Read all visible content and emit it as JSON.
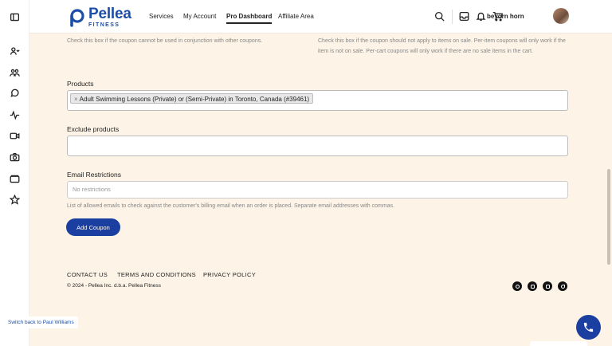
{
  "header": {
    "logo_name": "Pellea",
    "logo_sub": "FITNESS",
    "nav": [
      "Services",
      "My Account",
      "Pro Dashboard",
      "Affiliate Area"
    ],
    "active_nav": "Pro Dashboard",
    "username": "beyorn horn"
  },
  "form": {
    "individual_use_help": "Check this box if the coupon cannot be used in conjunction with other coupons.",
    "exclude_sale_help": "Check this box if the coupon should not apply to items on sale. Per-item coupons will only work if the item is not on sale. Per-cart coupons will only work if there are no sale items in the cart.",
    "products_label": "Products",
    "products_selected": "Adult Swimming Lessons (Private) or (Semi-Private) in Toronto, Canada (#39461)",
    "chip_remove": "×",
    "exclude_products_label": "Exclude products",
    "email_restrictions_label": "Email Restrictions",
    "email_restrictions_placeholder": "No restrictions",
    "email_restrictions_help": "List of allowed emails to check against the customer's billing email when an order is placed. Separate email addresses with commas.",
    "submit_label": "Add Coupon"
  },
  "footer": {
    "links": [
      "CONTACT US",
      "TERMS AND CONDITIONS",
      "PRIVACY POLICY"
    ],
    "copyright": "© 2024 - Pellea Inc. d.b.a. Pellea Fitness",
    "social": [
      "facebook-icon",
      "instagram-icon",
      "linkedin-icon",
      "twitter-icon"
    ]
  },
  "switch_back": "Switch back to Paul Williams",
  "colors": {
    "brand": "#1e4fa8",
    "button": "#1b3fa0",
    "background": "#fdf3e6"
  }
}
